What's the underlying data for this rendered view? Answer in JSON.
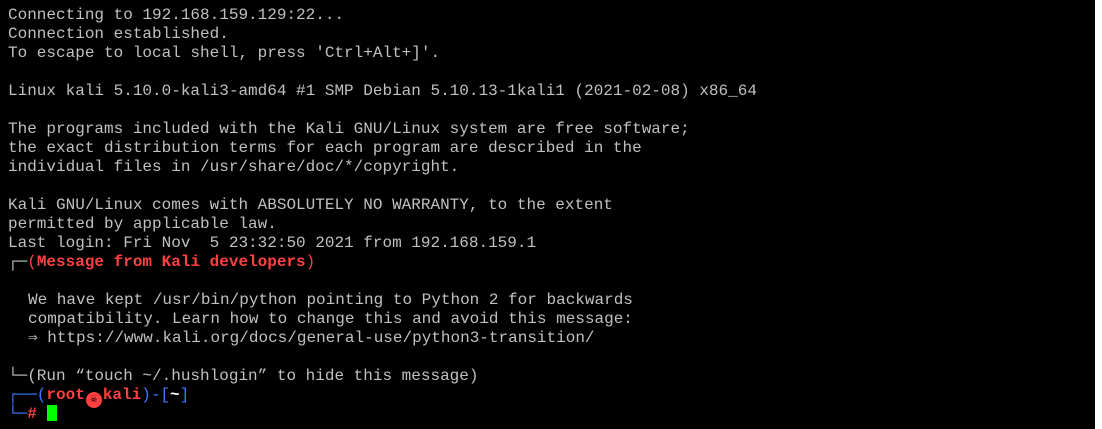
{
  "colors": {
    "background": "#000000",
    "foreground": "#c0c0c0",
    "prompt_frame": "#3b78ff",
    "prompt_text": "#ff4040",
    "cursor": "#00ff00"
  },
  "session": {
    "connecting": "Connecting to 192.168.159.129:22...",
    "established": "Connection established.",
    "escape_hint": "To escape to local shell, press 'Ctrl+Alt+]'.",
    "uname": "Linux kali 5.10.0-kali3-amd64 #1 SMP Debian 5.10.13-1kali1 (2021-02-08) x86_64",
    "license_1": "The programs included with the Kali GNU/Linux system are free software;",
    "license_2": "the exact distribution terms for each program are described in the",
    "license_3": "individual files in /usr/share/doc/*/copyright.",
    "warranty_1": "Kali GNU/Linux comes with ABSOLUTELY NO WARRANTY, to the extent",
    "warranty_2": "permitted by applicable law.",
    "last_login": "Last login: Fri Nov  5 23:32:50 2021 from 192.168.159.1"
  },
  "motd": {
    "header_frame": "┌─",
    "header_open": "(",
    "header_text": "Message from Kali developers",
    "header_close": ")",
    "body_1": "We have kept /usr/bin/python pointing to Python 2 for backwards",
    "body_2": "compatibility. Learn how to change this and avoid this message:",
    "body_3": "⇒ https://www.kali.org/docs/general-use/python3-transition/",
    "footer_frame": "└─",
    "footer_text": "(Run “touch ~/.hushlogin” to hide this message)"
  },
  "prompt": {
    "frame_top": "┌──(",
    "user": "root",
    "skull_icon": "☠",
    "host": "kali",
    "frame_mid": ")-[",
    "cwd": "~",
    "frame_end": "]",
    "frame_bottom": "└─",
    "symbol": "#"
  }
}
